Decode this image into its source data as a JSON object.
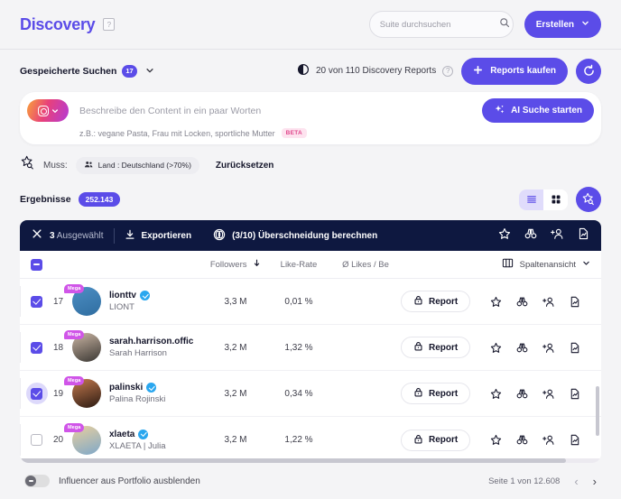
{
  "header": {
    "logo": "Discovery",
    "help_icon": "help-square-icon",
    "search_placeholder": "Suite durchsuchen",
    "search_value": "",
    "search_icon": "search-icon",
    "create_button": "Erstellen",
    "create_chevron": "chevron-down-icon"
  },
  "subheader": {
    "saved_searches_label": "Gespeicherte Suchen",
    "saved_searches_count": "17",
    "chevron": "chevron-down-icon",
    "reports_counter_icon": "contrast-circle-icon",
    "reports_counter": "20 von 110 Discovery Reports",
    "reports_help_icon": "help-circle-icon",
    "buy_reports_button": "Reports kaufen",
    "buy_plus_icon": "plus-icon",
    "refresh_icon": "refresh-circle-icon"
  },
  "ai_search": {
    "platform_icon": "instagram-icon",
    "platform_chevron": "chevron-down-icon",
    "input_placeholder": "Beschreibe den Content in ein paar Worten",
    "input_value": "",
    "start_button": "AI Suche starten",
    "sparkle_icon": "sparkles-icon",
    "hint": "z.B.: vegane Pasta, Frau mit Locken, sportliche Mutter",
    "beta_badge": "BETA"
  },
  "filters": {
    "star_icon": "star-search-icon",
    "must_label": "Muss:",
    "chips": [
      {
        "icon": "people-icon",
        "label": "Land : Deutschland (>70%)"
      }
    ],
    "reset_label": "Zurücksetzen"
  },
  "results": {
    "label": "Ergebnisse",
    "count": "252.143",
    "view_list_icon": "list-view-icon",
    "view_grid_icon": "grid-view-icon",
    "active_view": "list",
    "star_search_icon": "star-search-icon"
  },
  "selection_toolbar": {
    "close_icon": "close-icon",
    "selected_count": "3",
    "selected_label": "Ausgewählt",
    "export_icon": "download-icon",
    "export_label": "Exportieren",
    "overlap_icon": "overlap-circles-icon",
    "overlap_label": "(3/10) Überschneidung berechnen",
    "right_icons": [
      "star-icon",
      "binoculars-icon",
      "add-person-icon",
      "report-doc-icon"
    ]
  },
  "table": {
    "header_checkbox_state": "indeterminate",
    "columns": {
      "followers": "Followers",
      "followers_sort_icon": "sort-down-icon",
      "like_rate": "Like-Rate",
      "avg_likes": "Ø Likes / Be"
    },
    "column_view": {
      "icon": "columns-icon",
      "label": "Spaltenansicht",
      "chevron": "chevron-down-icon"
    },
    "rows": [
      {
        "checked": true,
        "highlighted": false,
        "index": "17",
        "badge": "Mega",
        "handle": "lionttv",
        "verified": true,
        "name": "LIONT",
        "followers": "3,3 M",
        "like_rate": "0,01 %",
        "avg_likes": "",
        "report_label": "Report",
        "report_icon": "lock-icon",
        "avatar_colors": [
          "#4d8fc4",
          "#2f6da0"
        ]
      },
      {
        "checked": true,
        "highlighted": false,
        "index": "18",
        "badge": "Mega",
        "handle": "sarah.harrison.offic",
        "verified": false,
        "name": "Sarah Harrison",
        "followers": "3,2 M",
        "like_rate": "1,32 %",
        "avg_likes": "",
        "report_label": "Report",
        "report_icon": "lock-icon",
        "avatar_colors": [
          "#cbb6a4",
          "#3a3733"
        ]
      },
      {
        "checked": true,
        "highlighted": true,
        "index": "19",
        "badge": "Mega",
        "handle": "palinski",
        "verified": true,
        "name": "Palina Rojinski",
        "followers": "3,2 M",
        "like_rate": "0,34 %",
        "avg_likes": "",
        "report_label": "Report",
        "report_icon": "lock-icon",
        "avatar_colors": [
          "#c47a4e",
          "#2b1a12"
        ]
      },
      {
        "checked": false,
        "highlighted": false,
        "index": "20",
        "badge": "Mega",
        "handle": "xlaeta",
        "verified": true,
        "name": "XLAETA | Julia",
        "followers": "3,2 M",
        "like_rate": "1,22 %",
        "avg_likes": "",
        "report_label": "Report",
        "report_icon": "lock-icon",
        "avatar_colors": [
          "#e8cf9e",
          "#7fa8c9"
        ]
      }
    ],
    "row_icons": [
      "star-icon",
      "binoculars-icon",
      "add-person-icon",
      "report-doc-icon"
    ]
  },
  "footer": {
    "toggle_state": "off",
    "toggle_label": "Influencer aus Portfolio ausblenden",
    "page_text": "Seite 1 von 12.608",
    "prev_icon": "chevron-left-icon",
    "next_icon": "chevron-right-icon"
  },
  "colors": {
    "accent": "#5b4ce8",
    "toolbar_dark": "#0e1840",
    "verified_blue": "#2aa7ef",
    "mega_badge": "#d055e8",
    "beta_pink": "#e0478c"
  }
}
